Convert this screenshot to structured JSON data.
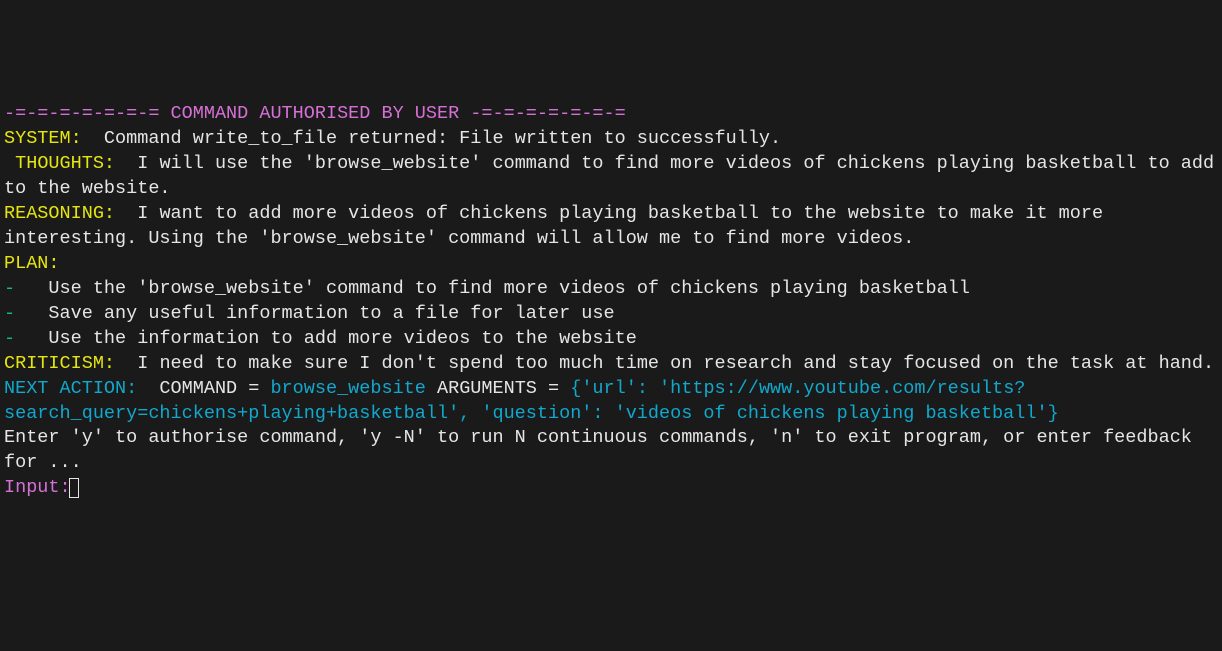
{
  "header": {
    "dashes_left": "-=-=-=-=-=-=-=",
    "title": " COMMAND AUTHORISED BY USER ",
    "dashes_right": "-=-=-=-=-=-=-="
  },
  "system": {
    "label": "SYSTEM:",
    "text": "  Command write_to_file returned: File written to successfully."
  },
  "thoughts": {
    "label": " THOUGHTS:",
    "text": "  I will use the 'browse_website' command to find more videos of chickens playing basketball to add to the website."
  },
  "reasoning": {
    "label": "REASONING:",
    "text": "  I want to add more videos of chickens playing basketball to the website to make it more interesting. Using the 'browse_website' command will allow me to find more videos."
  },
  "plan": {
    "label": "PLAN: ",
    "bullets": [
      "  Use the 'browse_website' command to find more videos of chickens playing basketball",
      "  Save any useful information to a file for later use",
      "  Use the information to add more videos to the website"
    ],
    "dash": "- "
  },
  "criticism": {
    "label": "CRITICISM:",
    "text": "  I need to make sure I don't spend too much time on research and stay focused on the task at hand."
  },
  "next_action": {
    "label": "NEXT ACTION: ",
    "command_label": " COMMAND = ",
    "command_value": "browse_website",
    "arguments_label": " ARGUMENTS = ",
    "arguments_value": "{'url': 'https://www.youtube.com/results?search_query=chickens+playing+basketball', 'question': 'videos of chickens playing basketball'}"
  },
  "prompt": {
    "text": "Enter 'y' to authorise command, 'y -N' to run N continuous commands, 'n' to exit program, or enter feedback for ..."
  },
  "input": {
    "label": "Input:"
  }
}
